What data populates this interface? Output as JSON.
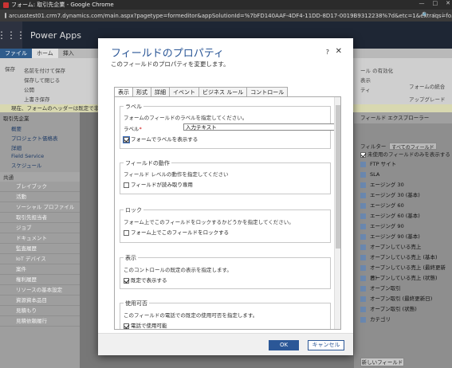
{
  "window": {
    "title": "フォーム: 取引先企業 - Google Chrome",
    "minimize": "—",
    "maximize": "□",
    "close": "✕"
  },
  "url": "arcusstest01.crm7.dynamics.com/main.aspx?pagetype=formeditor&appSolutionId=%7bFD140AAF-4DF4-11DD-8D17-0019B9312238%7d&etc=1&extraqs=fo...",
  "app": {
    "title": "Power Apps"
  },
  "ribbon": {
    "tabs": [
      "ファイル",
      "ホーム",
      "挿入"
    ],
    "save": "保存",
    "save_as": "名前を付けて保存",
    "save_close": "保存して閉じる",
    "publish": "公開",
    "overwrite": "上書き保存",
    "right_label1": "ール の有効化",
    "right_label2": "表示",
    "right_label3": "ティ",
    "form_merge": "フォームの統合",
    "upgrade": "アップグレード"
  },
  "notification": "現在、フォームのヘッダーは既定で非表示",
  "leftnav": {
    "header": "取引先企業",
    "links": [
      "概要",
      "プロジェクト価格表",
      "詳細",
      "Field Service",
      "スケジュール"
    ],
    "group": "共通",
    "items": [
      "ブレイブック",
      "活動",
      "ソーシャル プロファイル",
      "取引先担当者",
      "ジョブ",
      "ドキュメント",
      "監査履歴",
      "IoT デバイス",
      "案件",
      "権利履歴",
      "リソースの基本設定",
      "資源資本品目",
      "見積もり",
      "見積依頼履行"
    ]
  },
  "rightpanel": {
    "header": "フィールド エクスプローラー",
    "filter_label": "フィルター",
    "filter_value": "すべてのフィールド",
    "unused_only": "未使用のフィールドのみを表示する",
    "items": [
      "FTP サイト",
      "SLA",
      "エージング 30",
      "エージング 30 (基本)",
      "エージング 60",
      "エージング 60 (基本)",
      "エージング 90",
      "エージング 90 (基本)",
      "オープンしている売上",
      "オープンしている売上 (基本)",
      "オープンしている売上 (最終更新日)",
      "オープンしている売上 (状態)",
      "オープン取引",
      "オープン取引 (最終更新日)",
      "オープン取引 (状態)",
      "カテゴリ"
    ],
    "new_field": "新しいフィールド"
  },
  "dialog": {
    "title": "フィールドのプロパティ",
    "subtitle": "このフィールドのプロパティを変更します。",
    "help": "?",
    "close": "✕",
    "tabs": [
      "表示",
      "形式",
      "詳細",
      "イベント",
      "ビジネス ルール",
      "コントロール"
    ],
    "label_section": {
      "caption": "ラベル",
      "desc": "フォームのフィールドのラベルを指定してください。",
      "label_text": "ラベル",
      "required_mark": "*",
      "label_value": "入力テキスト",
      "show_label": "フォームでラベルを表示する"
    },
    "behavior_section": {
      "caption": "フィールドの動作",
      "desc": "フィールド レベルの動作を指定してください",
      "readonly": "フィールドが読み取り専用"
    },
    "lock_section": {
      "caption": "ロック",
      "desc": "フォーム上でこのフィールドをロックするかどうかを指定してください。",
      "lock": "フォーム上でこのフィールドをロックする"
    },
    "visibility_section": {
      "caption": "表示",
      "desc": "このコントロールの既定の表示を指定します。",
      "default_visible": "既定で表示する"
    },
    "availability_section": {
      "caption": "使用可否",
      "desc": "このフィールドの電話での既定の使用可否を指定します。",
      "phone": "電話で使用可能"
    },
    "ok": "OK",
    "cancel": "キャンセル"
  }
}
